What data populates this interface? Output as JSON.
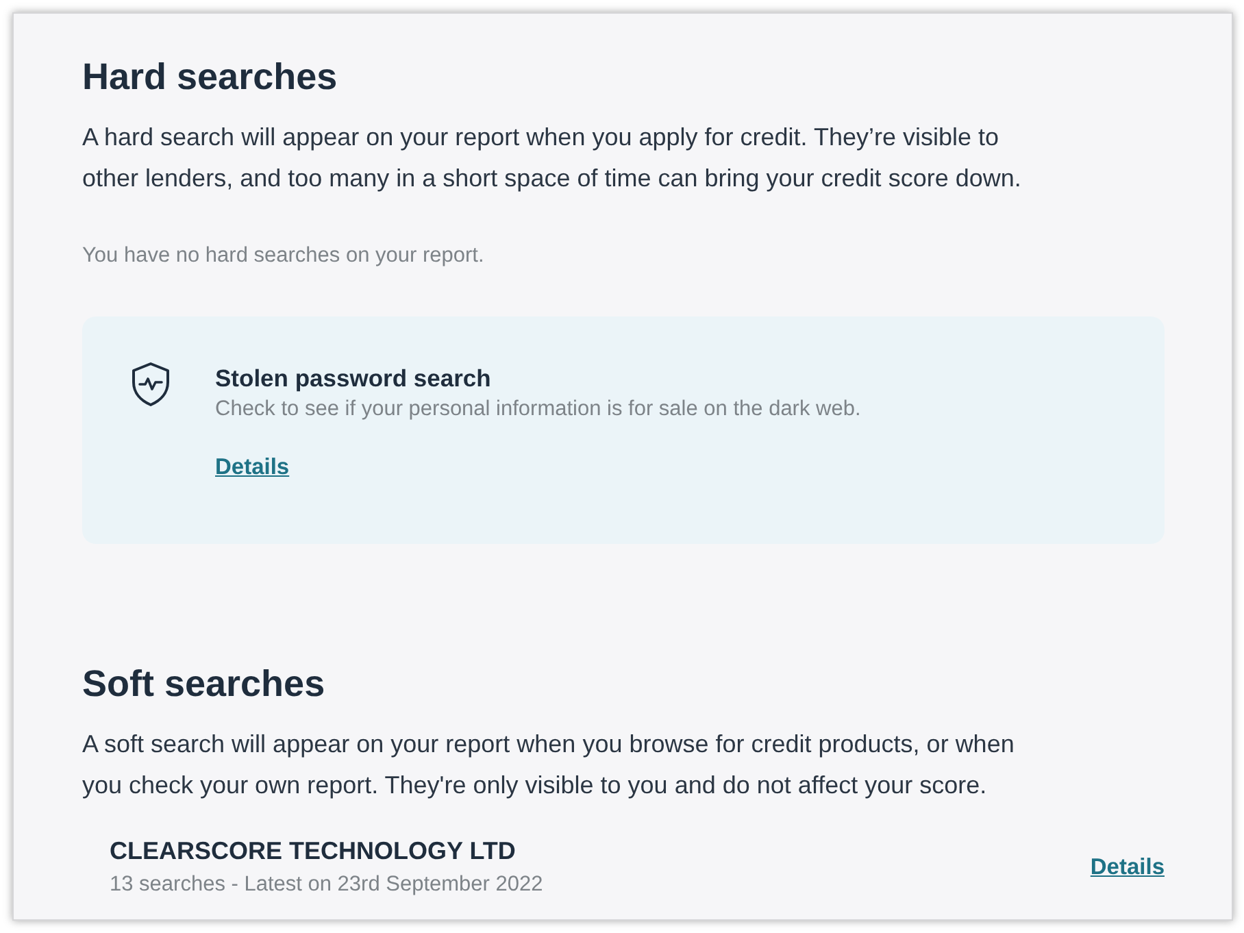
{
  "hard_searches": {
    "title": "Hard searches",
    "description": "A hard search will appear on your report when you apply for credit. They’re visible to other lenders, and too many in a short space of time can bring your credit score down.",
    "empty_message": "You have no hard searches on your report."
  },
  "promo_card": {
    "title": "Stolen password search",
    "description": "Check to see if your personal information is for sale on the dark web.",
    "link": "Details"
  },
  "soft_searches": {
    "title": "Soft searches",
    "description": "A soft search will appear on your report when you browse for credit products, or when you check your own report. They're only visible to you and do not affect your score.",
    "items": [
      {
        "name": "CLEARSCORE TECHNOLOGY LTD",
        "summary": "13 searches - Latest on 23rd September 2022",
        "link": "Details"
      }
    ]
  }
}
